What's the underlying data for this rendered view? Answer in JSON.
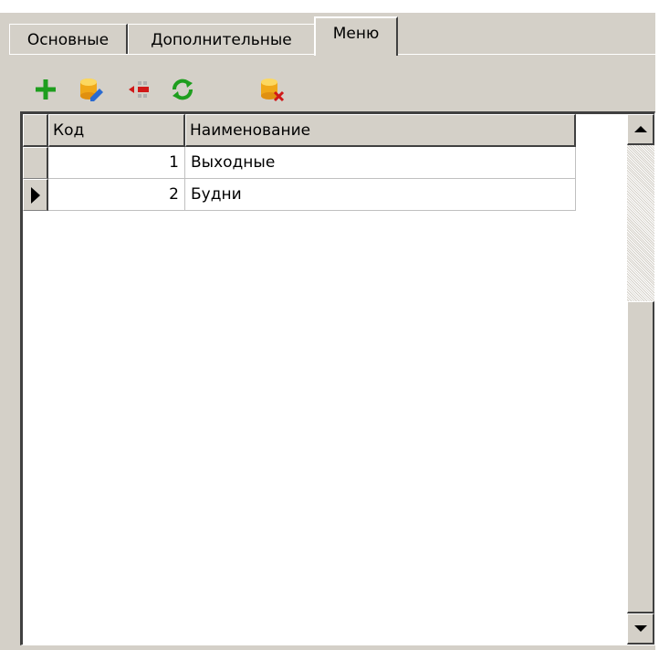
{
  "tabs": [
    {
      "label": "Основные",
      "active": false
    },
    {
      "label": "Дополнительные",
      "active": false
    },
    {
      "label": "Меню",
      "active": true
    }
  ],
  "toolbar": {
    "buttons": [
      {
        "icon": "add-icon",
        "color": "#1e9e1e"
      },
      {
        "icon": "edit-database-icon",
        "color": "#f0a818"
      },
      {
        "icon": "collapse-icon",
        "color": "#d01818"
      },
      {
        "icon": "refresh-icon",
        "color": "#1e9e1e"
      },
      {
        "icon": "delete-database-icon",
        "color": "#f0a818"
      }
    ]
  },
  "grid": {
    "columns": [
      "Код",
      "Наименование"
    ],
    "rows": [
      {
        "code": "1",
        "name": "Выходные",
        "current": false
      },
      {
        "code": "2",
        "name": "Будни",
        "current": true
      }
    ]
  },
  "colors": {
    "face": "#d4d0c8",
    "shadow": "#404040",
    "highlight": "#ffffff"
  }
}
